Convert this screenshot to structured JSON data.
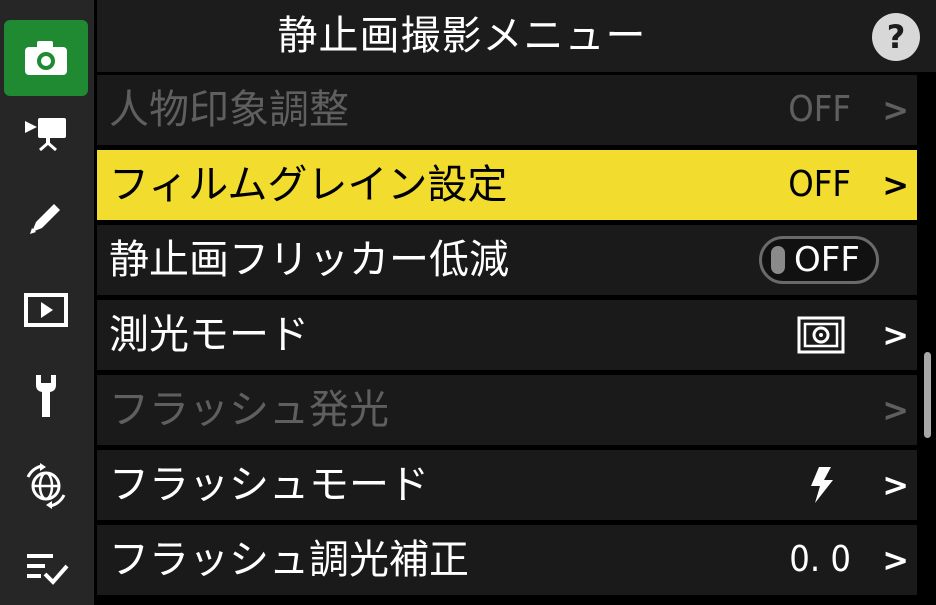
{
  "header": {
    "title": "静止画撮影メニュー",
    "help_label": "?"
  },
  "sidebar": {
    "tabs": [
      {
        "icon": "camera-icon",
        "active": true
      },
      {
        "icon": "movie-camera-icon",
        "active": false
      },
      {
        "icon": "pencil-icon",
        "active": false
      },
      {
        "icon": "playback-icon",
        "active": false
      },
      {
        "icon": "wrench-icon",
        "active": false
      },
      {
        "icon": "network-icon",
        "active": false
      },
      {
        "icon": "my-menu-icon",
        "active": false
      }
    ]
  },
  "menu": {
    "items": [
      {
        "label": "人物印象調整",
        "value": "OFF",
        "state": "disabled"
      },
      {
        "label": "フィルムグレイン設定",
        "value": "OFF",
        "state": "selected"
      },
      {
        "label": "静止画フリッカー低減",
        "value": "OFF",
        "state": "normal"
      },
      {
        "label": "測光モード",
        "value": "",
        "state": "normal"
      },
      {
        "label": "フラッシュ発光",
        "value": "",
        "state": "disabled"
      },
      {
        "label": "フラッシュモード",
        "value": "",
        "state": "normal"
      },
      {
        "label": "フラッシュ調光補正",
        "value": "0. 0",
        "state": "normal"
      }
    ],
    "chevron": ">"
  },
  "colors": {
    "accent_green": "#1f8a32",
    "highlight_yellow": "#f2dc2e",
    "disabled_gray": "#5f5f5f"
  }
}
